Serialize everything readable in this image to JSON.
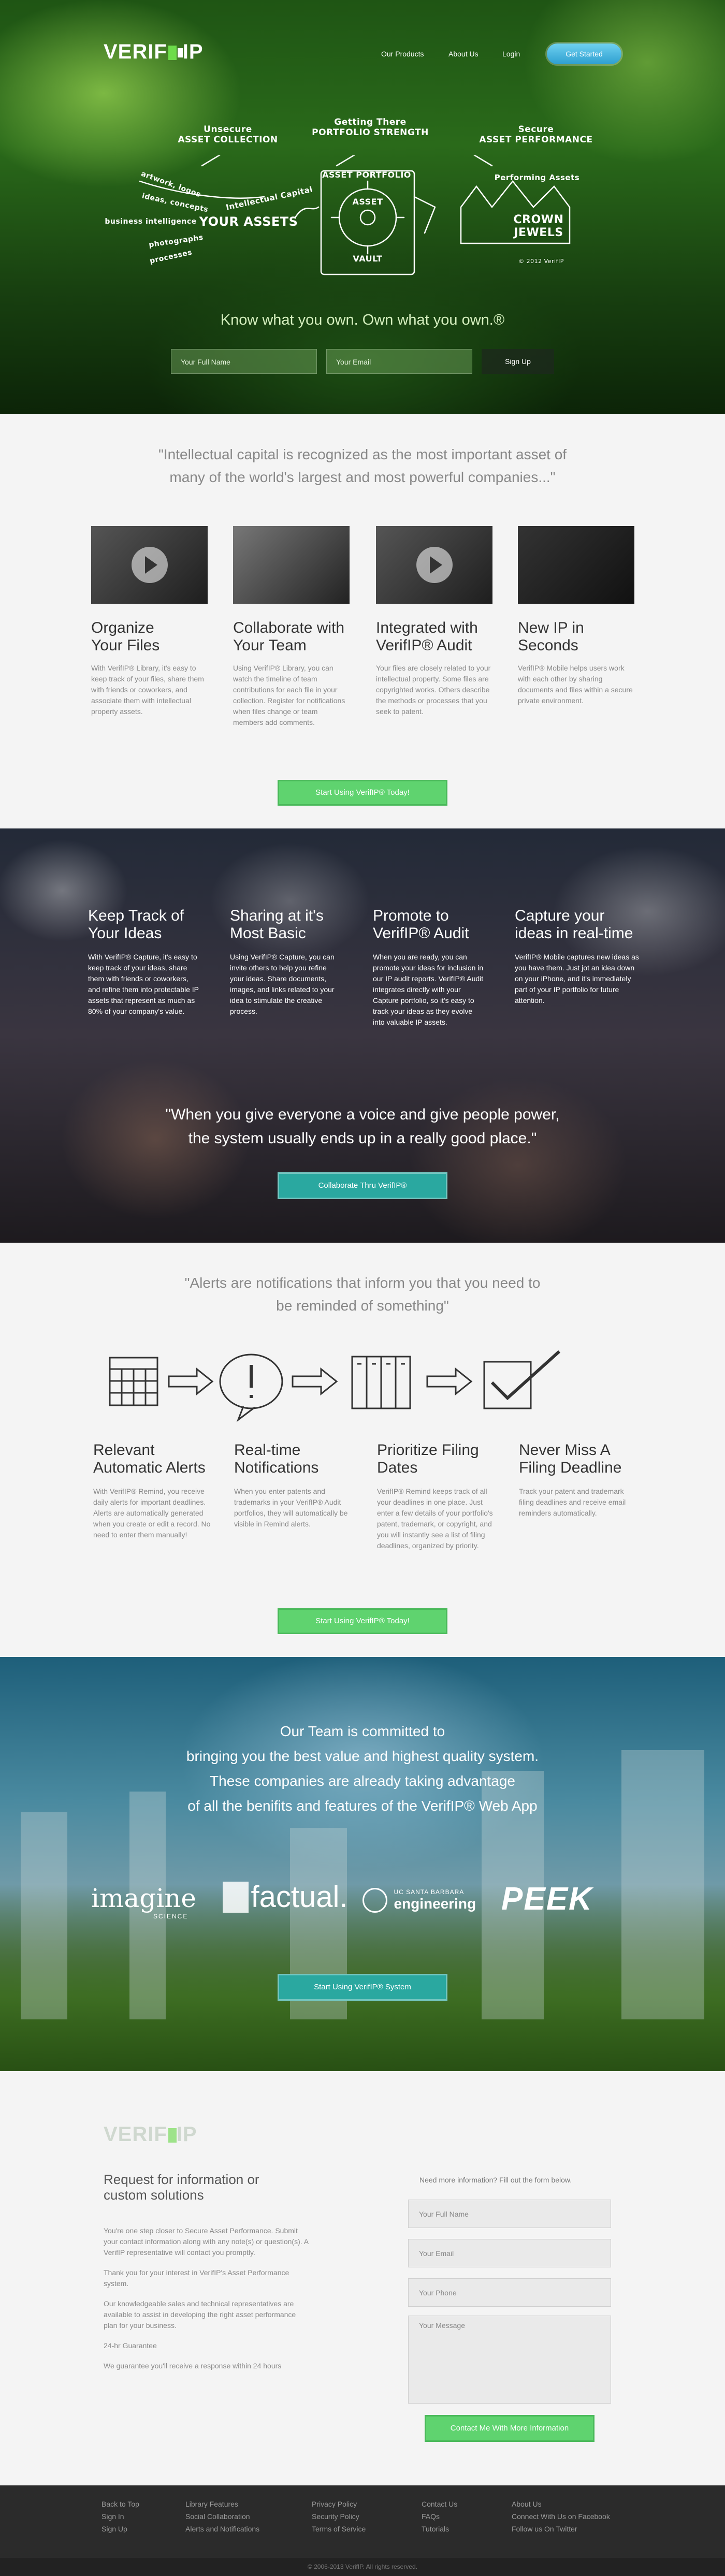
{
  "colors": {
    "accent_green": "#5fd36f",
    "accent_blue": "#2e9fd0",
    "teal": "#2aa8a0",
    "footer_bg": "#2b2b2b"
  },
  "header": {
    "logo_text": "VERIF",
    "logo_suffix": "IP",
    "nav": [
      "Our Products",
      "About Us",
      "Login"
    ],
    "cta": "Get Started"
  },
  "hero": {
    "chalk": {
      "unsecure_1": "Unsecure",
      "unsecure_2": "ASSET COLLECTION",
      "getting_1": "Getting There",
      "getting_2": "PORTFOLIO STRENGTH",
      "secure_1": "Secure",
      "secure_2": "ASSET PERFORMANCE",
      "portfolio": "ASSET PORTFOLIO",
      "your_assets": "YOUR ASSETS",
      "intellectual": "Intellectual Capital",
      "artwork": "artwork, logos",
      "ideas": "ideas, concepts",
      "business": "business intelligence",
      "photos": "photographs",
      "processes": "processes",
      "asset": "ASSET",
      "vault": "VAULT",
      "performing": "Performing Assets",
      "crown_1": "CROWN",
      "crown_2": "JEWELS",
      "copyright": "© 2012 VerifIP"
    },
    "tagline": "Know what you own. Own what you own.®",
    "name_placeholder": "Your Full Name",
    "email_placeholder": "Your Email",
    "signup": "Sign Up"
  },
  "quote1": {
    "line1": "\"Intellectual capital is recognized as the most important asset of",
    "line2": "many of the world's largest and most powerful companies...\""
  },
  "features1": [
    {
      "title1": "Organize",
      "title2": "Your Files",
      "text": "With VerifIP® Library, it's easy to keep track of your files, share them with friends or coworkers, and associate them with intellectual property assets."
    },
    {
      "title1": "Collaborate with",
      "title2": "Your Team",
      "text": "Using VerifIP® Library, you can watch the timeline of team contributions for each file in your collection. Register for notifications when files change or team members add comments."
    },
    {
      "title1": "Integrated with",
      "title2": "VerifIP® Audit",
      "text": "Your files are closely related to your intellectual property. Some files are copyrighted works. Others describe the methods or processes that you seek to patent."
    },
    {
      "title1": "New IP in",
      "title2": "Seconds",
      "text": "VerifIP® Mobile helps users work with each other by sharing documents and files within a secure private environment."
    }
  ],
  "cta1": "Start Using VerifIP® Today!",
  "features2": [
    {
      "title1": "Keep Track of",
      "title2": "Your Ideas",
      "text": "With VerifIP® Capture, it's easy to keep track of your ideas, share them with friends or coworkers, and refine them into protectable IP assets that represent as much as 80% of your company's value."
    },
    {
      "title1": "Sharing at it's",
      "title2": "Most Basic",
      "text": "Using VerifIP® Capture, you can invite others to help you refine your ideas. Share documents, images, and links related to your idea to stimulate the creative process."
    },
    {
      "title1": "Promote to",
      "title2": "VerifIP® Audit",
      "text": "When you are ready, you can promote your ideas for inclusion in our IP audit reports. VerifIP® Audit integrates directly with your Capture portfolio, so it's easy to track your ideas as they evolve into valuable IP assets."
    },
    {
      "title1": "Capture your",
      "title2": "ideas in real-time",
      "text": "VerifIP® Mobile captures new ideas as you have them. Just jot an idea down on your iPhone, and it's immediately part of your IP portfolio for future attention."
    }
  ],
  "quote2": {
    "line1": "\"When you give everyone a voice and give people power,",
    "line2": "the system usually ends up in a really good place.\""
  },
  "cta2": "Collaborate Thru VerifIP®",
  "quote3": {
    "line1": "\"Alerts are notifications that inform you that you need to",
    "line2": "be reminded of something\""
  },
  "features3": [
    {
      "title1": "Relevant",
      "title2": "Automatic Alerts",
      "text": "With VerifIP® Remind, you receive daily alerts for important deadlines. Alerts are automatically generated when you create or edit a record. No need to enter them manually!"
    },
    {
      "title1": "Real-time",
      "title2": "Notifications",
      "text": "When you enter patents and trademarks in your VerifIP® Audit portfolios, they will automatically be visible in Remind alerts."
    },
    {
      "title1": "Prioritize Filing",
      "title2": "Dates",
      "text": "VerifIP® Remind keeps track of all your deadlines in one place. Just enter a few details of your portfolio's patent, trademark, or copyright, and you will instantly see a list of filing deadlines, organized by priority."
    },
    {
      "title1": "Never Miss A",
      "title2": "Filing Deadline",
      "text": "Track your patent and trademark filing deadlines and receive email reminders automatically."
    }
  ],
  "cta3": "Start Using VerifIP® Today!",
  "team": {
    "line1": "Our Team is committed to",
    "line2": "bringing you the best value and highest quality system.",
    "line3": "These companies are already taking advantage",
    "line4": "of all the benifits and features of the VerifIP® Web App",
    "logos": {
      "imagine": "imagine",
      "imagine_sub": "SCIENCE",
      "factual": "factual.",
      "ucsb_top": "UC SANTA BARBARA",
      "ucsb": "engineering",
      "peek": "PEEK"
    },
    "cta": "Start Using VerifIP® System"
  },
  "contact": {
    "heading1": "Request for information or",
    "heading2": "custom solutions",
    "p1": "You're one step closer to Secure Asset Performance. Submit your contact information along with any note(s) or question(s). A VerifIP representative will contact you promptly.",
    "p2": "Thank you for your interest in VerifIP's Asset Performance system.",
    "p3": "Our knowledgeable sales and technical representatives are available to assist in developing the right asset performance plan for your business.",
    "p4": "24-hr Guarantee",
    "p5": "We guarantee you'll receive a response within 24 hours",
    "form_intro": "Need more information? Fill out the form below.",
    "name_ph": "Your Full Name",
    "email_ph": "Your Email",
    "phone_ph": "Your Phone",
    "message_ph": "Your Message",
    "submit": "Contact Me With More Information"
  },
  "footer": {
    "col1": [
      "Back to Top",
      "Sign In",
      "Sign Up"
    ],
    "col2": [
      "Library Features",
      "Social Collaboration",
      "Alerts and Notifications"
    ],
    "col3": [
      "Privacy Policy",
      "Security Policy",
      "Terms of Service"
    ],
    "col4": [
      "Contact Us",
      "FAQs",
      "Tutorials"
    ],
    "col5": [
      "About Us",
      "Connect With Us on Facebook",
      "Follow us On Twitter"
    ],
    "copyright": "© 2006-2013 VerifIP. All rights reserved."
  }
}
